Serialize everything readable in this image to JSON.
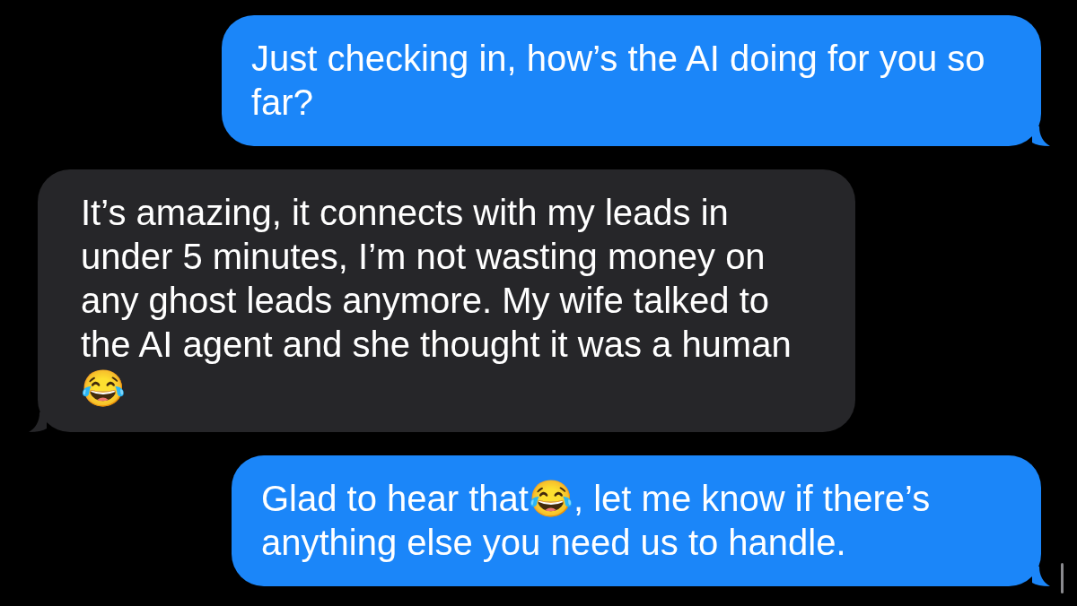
{
  "messages": [
    {
      "kind": "outgoing",
      "text": "Just checking in, how’s the AI doing for you so far?"
    },
    {
      "kind": "incoming",
      "text": "It’s amazing, it connects with my leads in under 5 minutes, I’m not wasting money on any ghost leads anymore. My wife talked to the AI agent and she thought it was a human😂"
    },
    {
      "kind": "outgoing",
      "text": "Glad to hear that😂, let me know if there’s anything else you need us to handle."
    }
  ]
}
